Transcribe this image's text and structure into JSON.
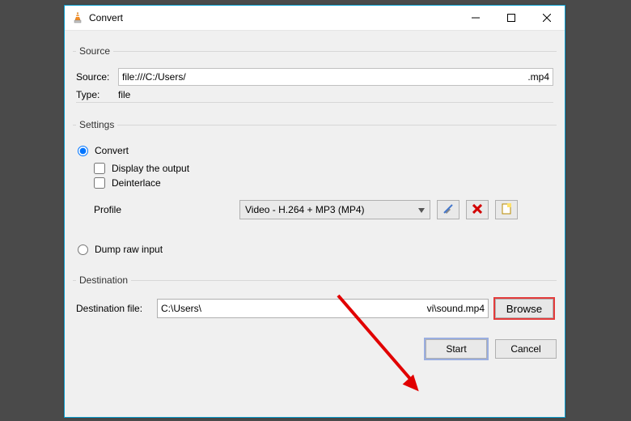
{
  "window": {
    "title": "Convert"
  },
  "source": {
    "group_label": "Source",
    "source_label": "Source:",
    "path_left": "file:///C:/Users/",
    "path_right": ".mp4",
    "type_label": "Type:",
    "type_value": "file"
  },
  "settings": {
    "group_label": "Settings",
    "convert_label": "Convert",
    "display_output_label": "Display the output",
    "deinterlace_label": "Deinterlace",
    "profile_label": "Profile",
    "profile_value": "Video - H.264 + MP3 (MP4)",
    "dump_raw_label": "Dump raw input"
  },
  "destination": {
    "group_label": "Destination",
    "dest_label": "Destination file:",
    "dest_left": "C:\\Users\\",
    "dest_right": "vi\\sound.mp4",
    "browse_label": "Browse"
  },
  "buttons": {
    "start": "Start",
    "cancel": "Cancel"
  }
}
